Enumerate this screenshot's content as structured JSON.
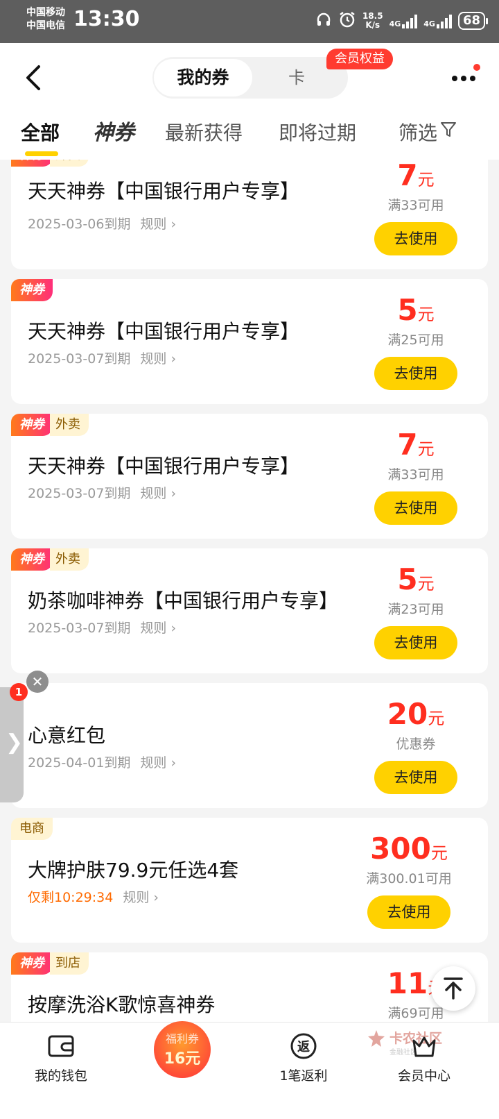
{
  "status_bar": {
    "carrier_1": "中国移动",
    "carrier_2": "中国电信",
    "time": "13:30",
    "speed_value": "18.5",
    "speed_unit": "K/s",
    "net1": "4G",
    "net2": "4G",
    "battery": "68"
  },
  "header": {
    "segment_active": "我的券",
    "segment_other": "卡",
    "vip_badge": "会员权益"
  },
  "tabs": {
    "all": "全部",
    "shen": "神券",
    "latest": "最新获得",
    "expiring": "即将过期",
    "filter": "筛选"
  },
  "coupons": [
    {
      "badge_shen": "神券",
      "badge_tag": "外卖",
      "title": "天天神券【中国银行用户专享】",
      "expire": "2025-03-06到期",
      "rule": "规则",
      "amount": "7",
      "unit": "元",
      "condition": "满33可用",
      "button": "去使用"
    },
    {
      "badge_shen": "神券",
      "badge_tag": "",
      "title": "天天神券【中国银行用户专享】",
      "expire": "2025-03-07到期",
      "rule": "规则",
      "amount": "5",
      "unit": "元",
      "condition": "满25可用",
      "button": "去使用"
    },
    {
      "badge_shen": "神券",
      "badge_tag": "外卖",
      "title": "天天神券【中国银行用户专享】",
      "expire": "2025-03-07到期",
      "rule": "规则",
      "amount": "7",
      "unit": "元",
      "condition": "满33可用",
      "button": "去使用"
    },
    {
      "badge_shen": "神券",
      "badge_tag": "外卖",
      "title": "奶茶咖啡神券【中国银行用户专享】",
      "expire": "2025-03-07到期",
      "rule": "规则",
      "amount": "5",
      "unit": "元",
      "condition": "满23可用",
      "button": "去使用"
    },
    {
      "badge_shen": "",
      "badge_tag": "",
      "title": "心意红包",
      "expire": "2025-04-01到期",
      "rule": "规则",
      "amount": "20",
      "unit": "元",
      "condition": "优惠券",
      "button": "去使用"
    },
    {
      "badge_shen": "",
      "badge_tag": "电商",
      "title": "大牌护肤79.9元任选4套",
      "expire": "仅剩10:29:34",
      "rule": "规则",
      "amount": "300",
      "unit": "元",
      "condition": "满300.01可用",
      "button": "去使用"
    },
    {
      "badge_shen": "神券",
      "badge_tag": "到店",
      "title": "按摩洗浴K歌惊喜神券",
      "expire": "",
      "rule": "",
      "amount": "11",
      "unit": "元",
      "condition": "满69可用",
      "button": ""
    }
  ],
  "side_float": {
    "badge_count": "1"
  },
  "bottom_nav": {
    "wallet": "我的钱包",
    "promo_top": "福利券",
    "promo_amount": "16元",
    "rebate": "1笔返利",
    "rebate_icon": "返",
    "member": "会员中心"
  },
  "watermark": {
    "text": "卡农社区",
    "sub": "金融社区"
  },
  "colors": {
    "accent": "#ffd100",
    "price": "#ff2e1f",
    "badge_red": "#ff3b30"
  }
}
